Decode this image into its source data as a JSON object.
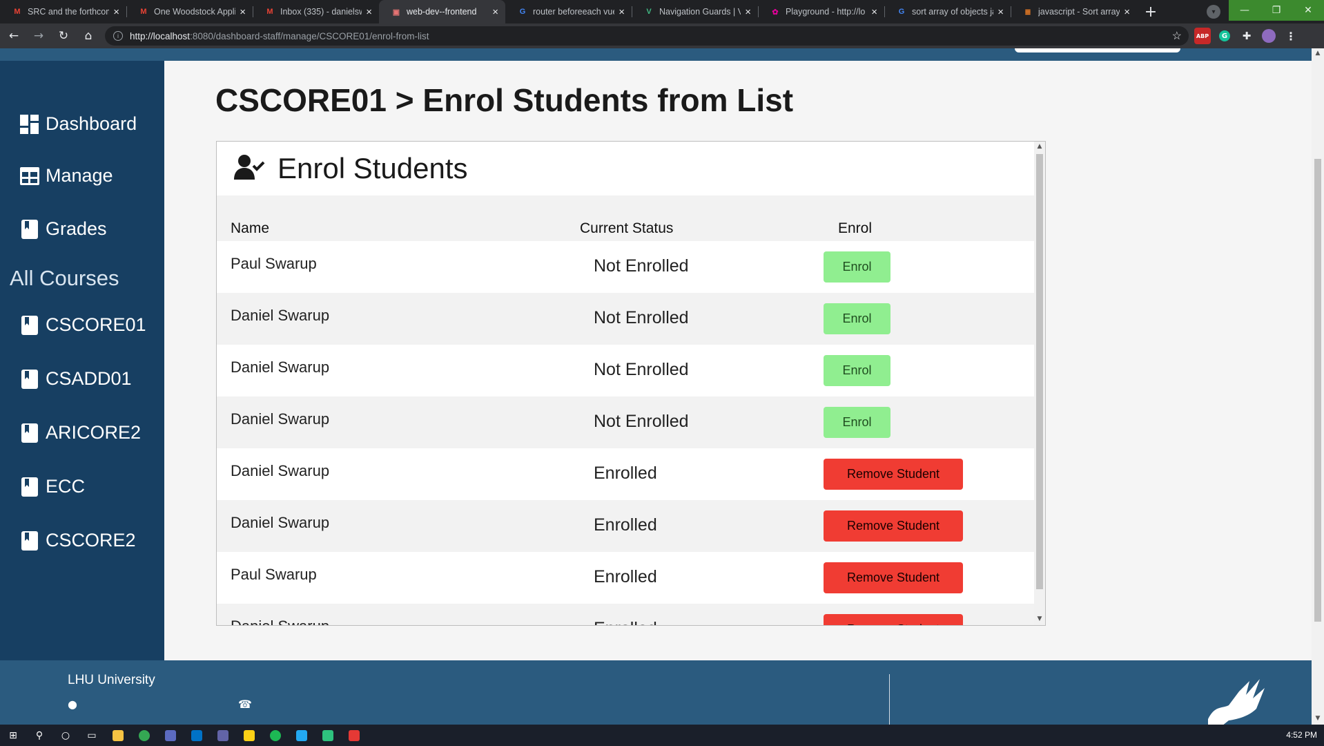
{
  "browser": {
    "tabs": [
      {
        "title": "SRC and the forthcom",
        "icon": "gmail-icon",
        "color": "#ea4335",
        "glyph": "M"
      },
      {
        "title": "One Woodstock Appli",
        "icon": "gmail-icon",
        "color": "#ea4335",
        "glyph": "M"
      },
      {
        "title": "Inbox (335) - danielsw",
        "icon": "gmail-icon",
        "color": "#ea4335",
        "glyph": "M"
      },
      {
        "title": "web-dev--frontend",
        "icon": "site-icon",
        "color": "#e57373",
        "glyph": "▣"
      },
      {
        "title": "router beforeeach vue",
        "icon": "google-icon",
        "color": "#4285f4",
        "glyph": "G"
      },
      {
        "title": "Navigation Guards | Vu",
        "icon": "vue-icon",
        "color": "#41b883",
        "glyph": "V"
      },
      {
        "title": "Playground - http://lo",
        "icon": "playground-icon",
        "color": "#e10098",
        "glyph": "✿"
      },
      {
        "title": "sort array of objects ja",
        "icon": "google-icon",
        "color": "#4285f4",
        "glyph": "G"
      },
      {
        "title": "javascript - Sort array",
        "icon": "stackoverflow-icon",
        "color": "#f48024",
        "glyph": "≣"
      }
    ],
    "url_host": "http://localhost",
    "url_rest": ":8080/dashboard-staff/manage/CSCORE01/enrol-from-list"
  },
  "sidebar": {
    "items": [
      {
        "label": "Dashboard",
        "icon": "dashboard-icon"
      },
      {
        "label": "Manage",
        "icon": "table-icon"
      },
      {
        "label": "Grades",
        "icon": "bookmark-icon"
      }
    ],
    "section_label": "All Courses",
    "courses": [
      {
        "label": "CSCORE01",
        "icon": "bookmark-icon"
      },
      {
        "label": "CSADD01",
        "icon": "bookmark-icon"
      },
      {
        "label": "ARICORE2",
        "icon": "bookmark-icon"
      },
      {
        "label": "ECC",
        "icon": "bookmark-icon"
      },
      {
        "label": "CSCORE2",
        "icon": "bookmark-icon"
      }
    ]
  },
  "main": {
    "title": "CSCORE01 > Enrol Students from List",
    "panel": {
      "title": "Enrol Students",
      "headers": {
        "name": "Name",
        "status": "Current Status",
        "action": "Enrol"
      },
      "rows": [
        {
          "name": "Paul Swarup",
          "status": "Not Enrolled",
          "action": "Enrol",
          "type": "enrol"
        },
        {
          "name": "Daniel Swarup",
          "status": "Not Enrolled",
          "action": "Enrol",
          "type": "enrol"
        },
        {
          "name": "Daniel Swarup",
          "status": "Not Enrolled",
          "action": "Enrol",
          "type": "enrol"
        },
        {
          "name": "Daniel Swarup",
          "status": "Not Enrolled",
          "action": "Enrol",
          "type": "enrol"
        },
        {
          "name": "Daniel Swarup",
          "status": "Enrolled",
          "action": "Remove Student",
          "type": "remove"
        },
        {
          "name": "Daniel Swarup",
          "status": "Enrolled",
          "action": "Remove Student",
          "type": "remove"
        },
        {
          "name": "Paul Swarup",
          "status": "Enrolled",
          "action": "Remove Student",
          "type": "remove"
        },
        {
          "name": "Daniel Swarup",
          "status": "Enrolled",
          "action": "Remove Student",
          "type": "remove"
        }
      ]
    }
  },
  "footer": {
    "university": "LHU University"
  },
  "taskbar": {
    "time": "4:52 PM"
  },
  "colors": {
    "sidebar": "#173f62",
    "footer": "#2b5b7f",
    "enrol_button": "#90ee90",
    "remove_button": "#f03c33"
  }
}
